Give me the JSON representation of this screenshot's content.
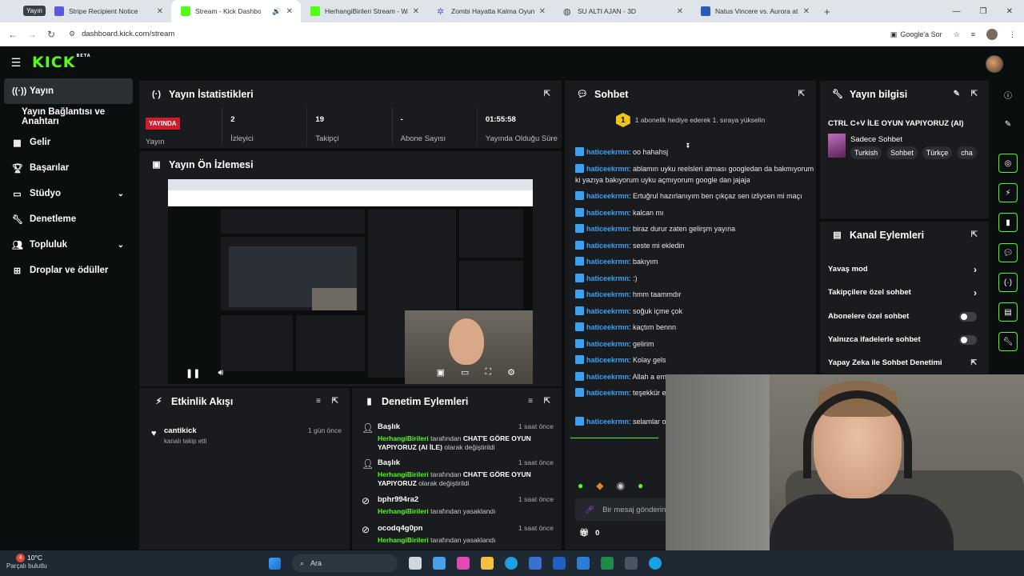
{
  "browser": {
    "profile_badge": "Yayın",
    "tabs": [
      {
        "label": "Stripe Recipient Notice",
        "color": "#5b5bd6"
      },
      {
        "label": "Stream - Kick Dashboard",
        "color": "#53fc18"
      },
      {
        "label": "HerhangiBirileri Stream - Watch",
        "color": "#53fc18"
      },
      {
        "label": "Zombi Hayatta Kalma Oyunu G...",
        "color": "#6b5bd6"
      },
      {
        "label": "SU ALTI AJAN - 3D",
        "color": "#444"
      },
      {
        "label": "Natus Vincere vs. Aurora at IEM",
        "color": "#2b5bb5"
      }
    ],
    "url": "dashboard.kick.com/stream",
    "google_sor": "Google'a Sor"
  },
  "kick": {
    "logo": "KICK",
    "beta": "BETA"
  },
  "sidebar": {
    "items": [
      {
        "label": "Yayın",
        "icon": "broadcast-icon"
      },
      {
        "label": "Yayın Bağlantısı ve Anahtarı",
        "icon": ""
      },
      {
        "label": "Gelir",
        "icon": "bars-icon"
      },
      {
        "label": "Başarılar",
        "icon": "trophy-icon"
      },
      {
        "label": "Stüdyo",
        "icon": "studio-icon"
      },
      {
        "label": "Denetleme",
        "icon": "wrench-icon"
      },
      {
        "label": "Topluluk",
        "icon": "community-icon"
      },
      {
        "label": "Droplar ve ödüller",
        "icon": "gift-icon"
      }
    ]
  },
  "stats": {
    "title": "Yayın İstatistikleri",
    "live_badge": "YAYINDA",
    "items": [
      {
        "value": "",
        "label": "Yayın"
      },
      {
        "value": "2",
        "label": "İzleyici"
      },
      {
        "value": "19",
        "label": "Takipçi"
      },
      {
        "value": "-",
        "label": "Abone Sayısı"
      },
      {
        "value": "01:55:58",
        "label": "Yayında Olduğu Süre"
      }
    ]
  },
  "preview": {
    "title": "Yayın Ön İzlemesi"
  },
  "activity": {
    "title": "Etkinlik Akışı",
    "items": [
      {
        "name": "cantikick",
        "desc": "kanalı takip etti",
        "time": "1 gün önce"
      }
    ]
  },
  "mod": {
    "title": "Denetim Eylemleri",
    "items": [
      {
        "title": "Başlık",
        "user": "HerhangiBirileri",
        "mid": "tarafından",
        "hl": "CHAT'E GÖRE OYUN YAPIYORUZ (AI İLE)",
        "tail": "olarak değiştirildi",
        "time": "1 saat önce"
      },
      {
        "title": "Başlık",
        "user": "HerhangiBirileri",
        "mid": "tarafından",
        "hl": "CHAT'E GÖRE OYUN YAPIYORUZ",
        "tail": "olarak değiştirildi",
        "time": "1 saat önce"
      },
      {
        "title": "bphr994ra2",
        "user": "HerhangiBirileri",
        "mid": "tarafından yasaklandı",
        "hl": "",
        "tail": "",
        "time": "1 saat önce"
      },
      {
        "title": "ocodq4g0pn",
        "user": "HerhangiBirileri",
        "mid": "tarafından yasaklandı",
        "hl": "",
        "tail": "",
        "time": "1 saat önce"
      }
    ]
  },
  "chat": {
    "title": "Sohbet",
    "notice": "1 abonelik hediye ederek 1. sıraya yükselin",
    "sub_rank": "1",
    "messages": [
      {
        "user": "haticeekrmn",
        "text": ": oo hahahsj"
      },
      {
        "user": "haticeekrmn",
        "text": ": ablamın uyku reelsleri atması googledan da bakmıyorum ki yazıya bakıyorum uyku açmıyorum google dan jajaja"
      },
      {
        "user": "haticeekrmn",
        "text": ": Ertuğrul hazırlanıyım ben çıkçaz sen izliycen mi maçı"
      },
      {
        "user": "haticeekrmn",
        "text": ": kalcan mı"
      },
      {
        "user": "haticeekrmn",
        "text": ": biraz durur zaten gelirşm yayına"
      },
      {
        "user": "haticeekrmn",
        "text": ": seste mi ekledin"
      },
      {
        "user": "haticeekrmn",
        "text": ": bakıyım"
      },
      {
        "user": "haticeekrmn",
        "text": ": :)"
      },
      {
        "user": "haticeekrmn",
        "text": ": hmm taammdır"
      },
      {
        "user": "haticeekrmn",
        "text": ": soğuk içme çok"
      },
      {
        "user": "haticeekrmn",
        "text": ": kaçtım bennn"
      },
      {
        "user": "haticeekrmn",
        "text": ": gelirim"
      },
      {
        "user": "haticeekrmn",
        "text": ": Kolay gels"
      },
      {
        "user": "haticeekrmn",
        "text": ": Allah a em"
      },
      {
        "user": "haticeekrmn",
        "text": ": teşekkür e"
      },
      {
        "user": "haticeekrmn",
        "text": ": selamlar oldu mu jajsjs"
      }
    ],
    "input_placeholder": "Bir mesaj gönderin",
    "viewer_count": "0"
  },
  "info": {
    "title": "Yayın bilgisi",
    "stream_title": "CTRL C+V İLE OYUN YAPIYORUZ (AI)",
    "category": "Sadece Sohbet",
    "tags": [
      "Turkish",
      "Sohbet",
      "Türkçe",
      "cha"
    ]
  },
  "channel": {
    "title": "Kanal Eylemleri",
    "rows": [
      {
        "label": "Yavaş mod",
        "ctrl": "chevron"
      },
      {
        "label": "Takipçilere özel sohbet",
        "ctrl": "chevron"
      },
      {
        "label": "Abonelere özel sohbet",
        "ctrl": "toggle"
      },
      {
        "label": "Yalnızca ifadelerle sohbet",
        "ctrl": "toggle"
      },
      {
        "label": "Yapay Zeka ile Sohbet Denetimi",
        "ctrl": "external"
      }
    ]
  },
  "taskbar": {
    "temp": "10°C",
    "weather": "Parçalı bulutlu",
    "search": "Ara",
    "weather_alert": "4"
  }
}
